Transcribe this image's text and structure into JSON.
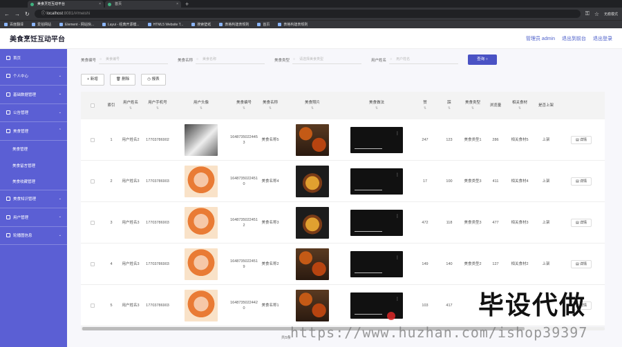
{
  "browser": {
    "tabs": [
      {
        "label": "美食烹饪互动平台"
      },
      {
        "label": "首页"
      }
    ],
    "url_host": "localhost",
    "url_path": ":8081/#/meishi",
    "profile": "无痕模式",
    "bookmarks": [
      "百度翻译",
      "爱拍网站",
      "Element - 网站快...",
      "Layui - 经典开源模...",
      "HTML5 Website T...",
      "搜索壁纸",
      "表格构建表规则",
      "首页",
      "表格构建表规则"
    ]
  },
  "header": {
    "brand": "美食烹饪互动平台",
    "links": [
      "管理员 admin",
      "退出到前台",
      "退出登录"
    ]
  },
  "sidebar": {
    "items": [
      {
        "label": "首页",
        "chevron": ""
      },
      {
        "label": "个人中心",
        "chevron": "⌄"
      },
      {
        "label": "基础数据管理",
        "chevron": "⌄"
      },
      {
        "label": "公告管理",
        "chevron": "⌄"
      },
      {
        "label": "美食管理",
        "chevron": "⌃"
      }
    ],
    "sub_items": [
      "美食管理",
      "美食留言管理",
      "美食收藏管理"
    ],
    "items_after": [
      {
        "label": "美食知识管理",
        "chevron": "⌄"
      },
      {
        "label": "用户管理",
        "chevron": "⌄"
      },
      {
        "label": "轮播图信息",
        "chevron": "⌄"
      }
    ]
  },
  "search": {
    "fields": [
      {
        "label": "美食编号",
        "placeholder": "美食编号"
      },
      {
        "label": "美食名称",
        "placeholder": "美食名称"
      },
      {
        "label": "美食类型",
        "placeholder": "请选择美食类型"
      },
      {
        "label": "用户姓名",
        "placeholder": "用户姓名"
      }
    ],
    "query_label": "查询 ○"
  },
  "actions": {
    "add": "+ 新增",
    "delete": "🗑 删除",
    "report": "◷ 报表"
  },
  "table": {
    "headers": [
      "",
      "索引",
      "用户姓名",
      "用户手机号",
      "用户头像",
      "美食编号",
      "美食名称",
      "美食照片",
      "美食做法",
      "赞",
      "踩",
      "美食类型",
      "浏览量",
      "相关食材",
      "是否上架",
      ""
    ],
    "detail_label": "▤ 详情",
    "rows": [
      {
        "idx": "1",
        "name": "用户姓名2",
        "phone": "17703786902",
        "avatar": "dog",
        "code": "16487350224453",
        "food": "美食名称5",
        "photo": "a",
        "up": "247",
        "down": "123",
        "type": "美食类型1",
        "views": "286",
        "ingredient": "相关食材5",
        "status": "上架"
      },
      {
        "idx": "2",
        "name": "用户姓名3",
        "phone": "17703786903",
        "avatar": "girl",
        "code": "16487350224510",
        "food": "美食名称4",
        "photo": "b",
        "up": "17",
        "down": "100",
        "type": "美食类型3",
        "views": "411",
        "ingredient": "相关食材4",
        "status": "上架"
      },
      {
        "idx": "3",
        "name": "用户姓名3",
        "phone": "17703786903",
        "avatar": "girl",
        "code": "16487350224512",
        "food": "美食名称3",
        "photo": "b",
        "up": "472",
        "down": "118",
        "type": "美食类型3",
        "views": "477",
        "ingredient": "相关食材3",
        "status": "上架"
      },
      {
        "idx": "4",
        "name": "用户姓名3",
        "phone": "17703786903",
        "avatar": "girl",
        "code": "16487350224519",
        "food": "美食名称2",
        "photo": "a",
        "up": "149",
        "down": "140",
        "type": "美食类型2",
        "views": "127",
        "ingredient": "相关食材2",
        "status": "上架"
      },
      {
        "idx": "5",
        "name": "用户姓名3",
        "phone": "17703786903",
        "avatar": "girl",
        "code": "16487350224420",
        "food": "美食名称1",
        "photo": "a",
        "up": "103",
        "down": "417",
        "type": "",
        "views": "",
        "ingredient": "",
        "status": ""
      }
    ]
  },
  "pager": "共5条",
  "watermark": {
    "text": "毕设代做",
    "url": "https://www.huzhan.com/ishop39397"
  }
}
